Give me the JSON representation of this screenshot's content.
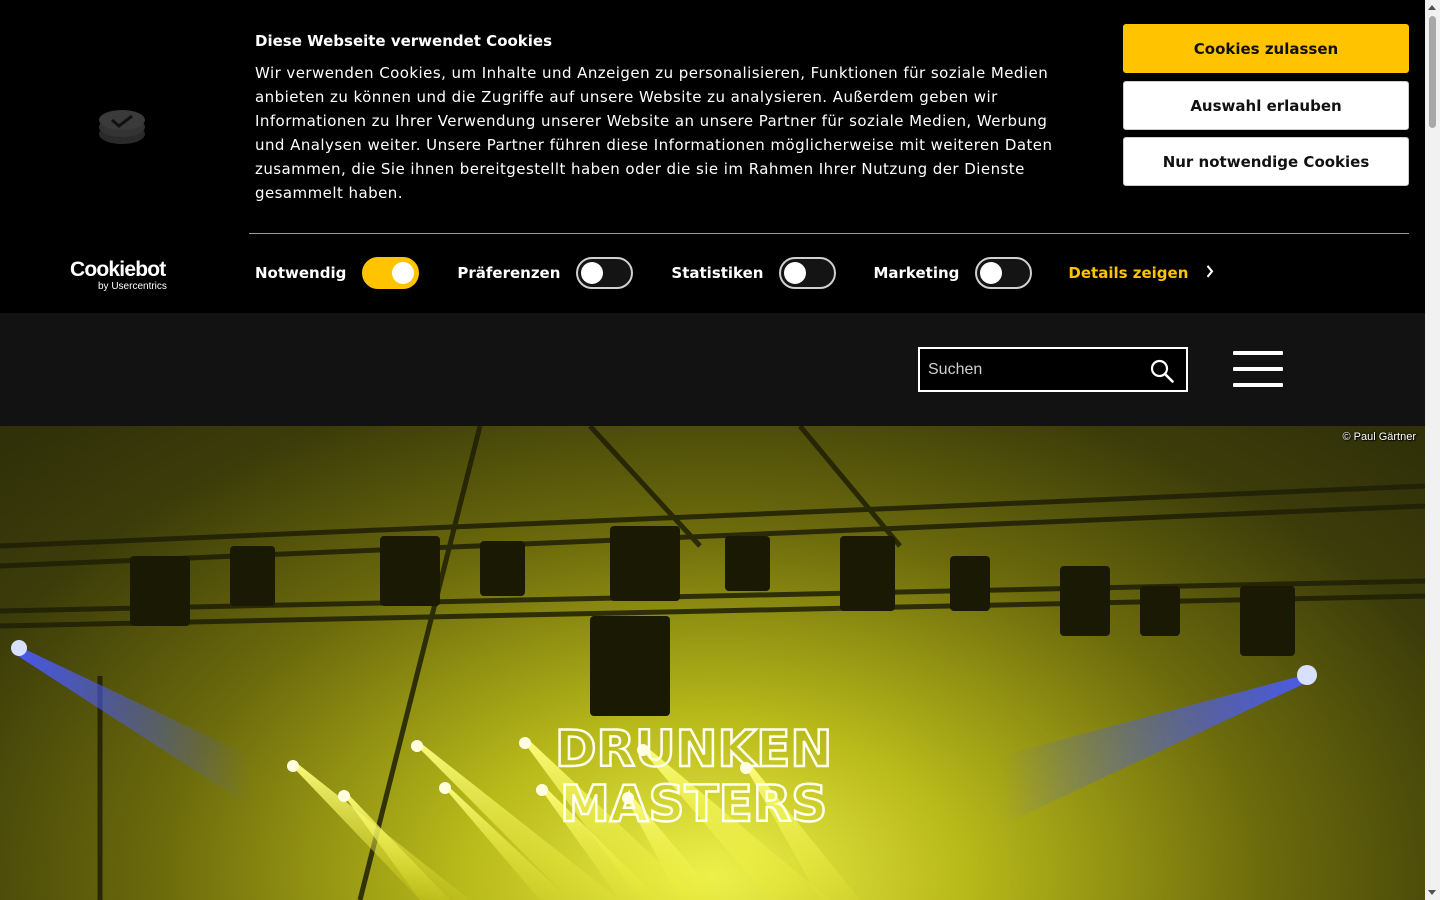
{
  "cookie_banner": {
    "title": "Diese Webseite verwendet Cookies",
    "text": "Wir verwenden Cookies, um Inhalte und Anzeigen zu personalisieren, Funktionen für soziale Medien anbieten zu können und die Zugriffe auf unsere Website zu analysieren. Außerdem geben wir Informationen zu Ihrer Verwendung unserer Website an unsere Partner für soziale Medien, Werbung und Analysen weiter. Unsere Partner führen diese Informationen möglicherweise mit weiteren Daten zusammen, die Sie ihnen bereitgestellt haben oder die sie im Rahmen Ihrer Nutzung der Dienste gesammelt haben.",
    "buttons": {
      "allow_all": "Cookies zulassen",
      "allow_selection": "Auswahl erlauben",
      "necessary_only": "Nur notwendige Cookies"
    },
    "consent_options": [
      {
        "label": "Notwendig",
        "checked": true
      },
      {
        "label": "Präferenzen",
        "checked": false
      },
      {
        "label": "Statistiken",
        "checked": false
      },
      {
        "label": "Marketing",
        "checked": false
      }
    ],
    "details_link": "Details zeigen",
    "provider_logo": {
      "name": "Cookiebot",
      "sub": "by Usercentrics"
    }
  },
  "header": {
    "search_placeholder": "Suchen"
  },
  "hero": {
    "photo_credit": "© Paul Gärtner",
    "sign_line1": "DRUNKEN",
    "sign_line2": "MASTERS"
  },
  "colors": {
    "accent": "#ffc300",
    "banner_bg": "#000000",
    "header_bg": "#121212"
  },
  "icons": {
    "search": "search-icon",
    "menu": "hamburger-menu-icon",
    "details": "chevron-right-icon"
  }
}
